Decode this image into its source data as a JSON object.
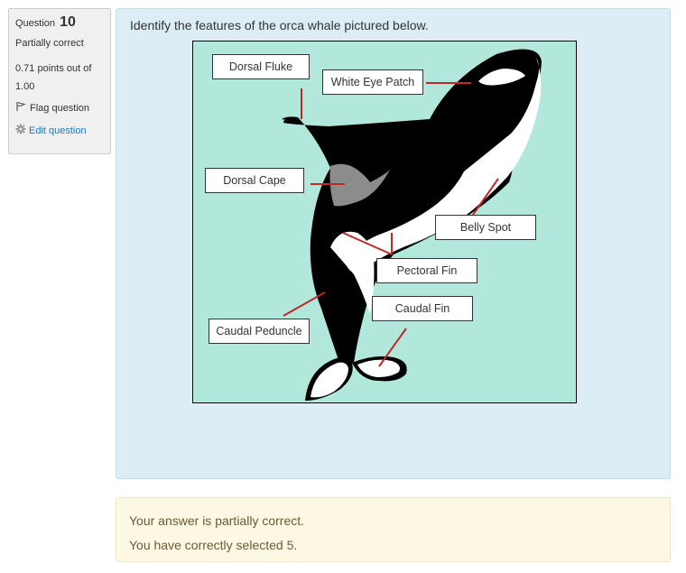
{
  "info": {
    "question_label": "Question",
    "question_number": "10",
    "state": "Partially correct",
    "grade": "0.71 points out of 1.00",
    "flag_label": "Flag question",
    "edit_label": "Edit question"
  },
  "question": {
    "text": "Identify the features of the orca whale pictured below."
  },
  "drops": [
    {
      "label": "Dorsal Fluke"
    },
    {
      "label": "White Eye Patch"
    },
    {
      "label": "Dorsal Cape"
    },
    {
      "label": "Belly Spot"
    },
    {
      "label": "Pectoral Fin"
    },
    {
      "label": "Caudal Fin"
    },
    {
      "label": "Caudal Peduncle"
    }
  ],
  "feedback": {
    "line1": "Your answer is partially correct.",
    "line2": "You have correctly selected 5."
  },
  "colors": {
    "background_area": "#b2e8db",
    "marker_line": "#c0282a",
    "orca_black": "#000000",
    "orca_white": "#ffffff",
    "cape_grey": "#8c8c8c"
  }
}
